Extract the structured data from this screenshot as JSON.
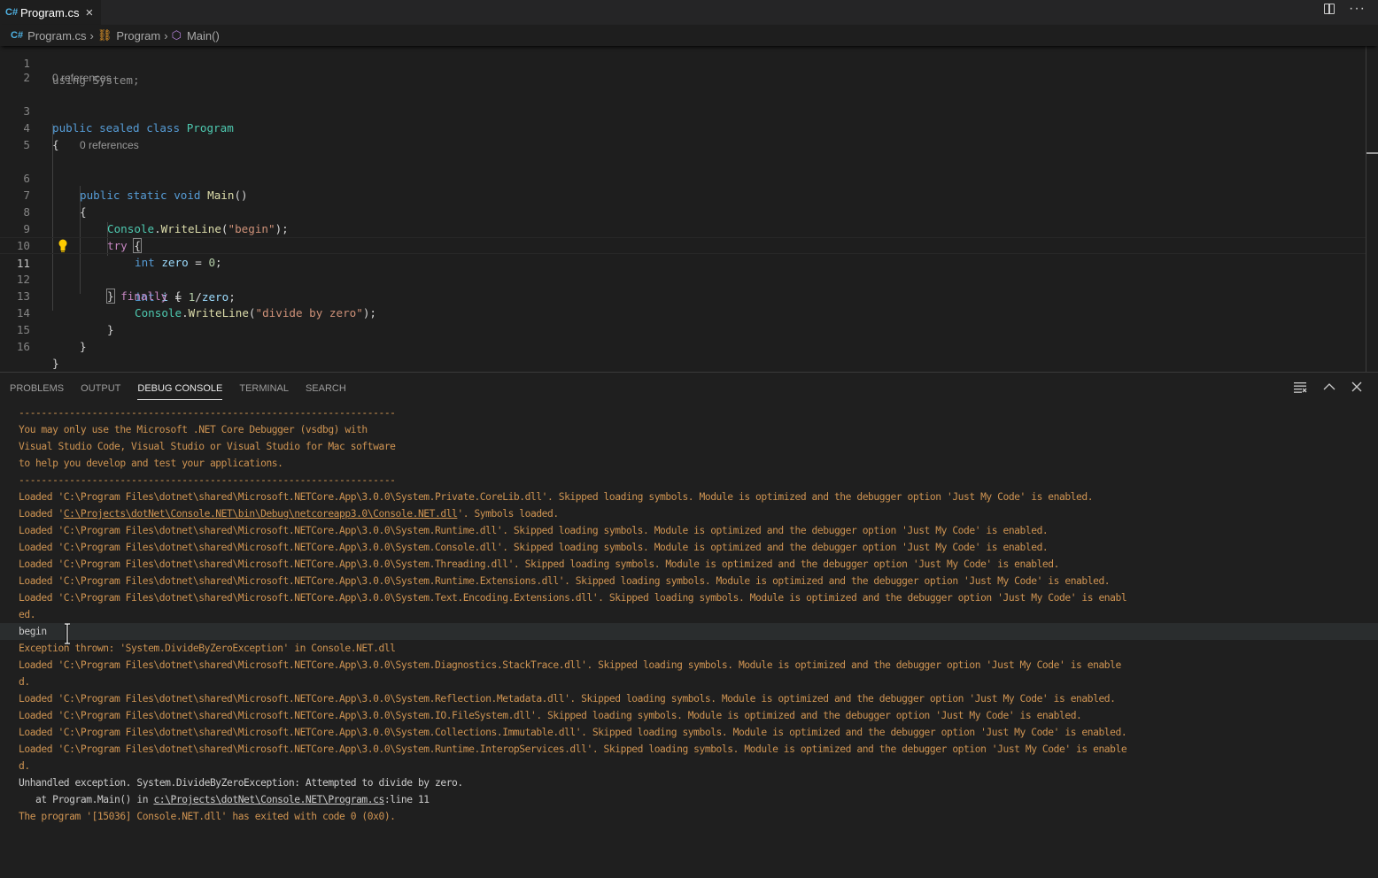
{
  "tab": {
    "label": "Program.cs",
    "icon": "csharp-file-icon"
  },
  "editor_actions": {
    "split": "split-editor-icon",
    "more": "ellipsis-icon"
  },
  "breadcrumb": [
    {
      "label": "Program.cs",
      "icon": "csharp-file-icon"
    },
    {
      "label": "Program",
      "icon": "class-icon"
    },
    {
      "label": "Main()",
      "icon": "method-cube-icon"
    }
  ],
  "code": {
    "codelens": "0 references",
    "partial_line1": "using System;",
    "lines": [
      "1",
      "2",
      "3",
      "4",
      "5",
      "6",
      "7",
      "8",
      "9",
      "10",
      "11",
      "12",
      "13",
      "14",
      "15",
      "16"
    ],
    "t": {
      "public": "public",
      "sealed": "sealed",
      "class": "class",
      "Program": "Program",
      "static": "static",
      "void": "void",
      "Main": "Main",
      "parens": "()",
      "lbrace": "{",
      "rbrace": "}",
      "Console": "Console",
      "dot": ".",
      "WriteLine": "WriteLine",
      "lp": "(",
      "rp_semi": ");",
      "begin_str": "\"begin\"",
      "try": "try",
      "int": "int",
      "zero": "zero",
      "i": "i",
      "eq": " = ",
      "zero_num": "0",
      "semi": ";",
      "one": "1",
      "slash": "/",
      "finally": "finally",
      "divide_str": "\"divide by zero\""
    }
  },
  "panel": {
    "tabs": [
      {
        "label": "PROBLEMS",
        "active": false
      },
      {
        "label": "OUTPUT",
        "active": false
      },
      {
        "label": "DEBUG CONSOLE",
        "active": true
      },
      {
        "label": "TERMINAL",
        "active": false
      },
      {
        "label": "SEARCH",
        "active": false
      }
    ],
    "actions": [
      "clear-console-icon",
      "maximize-panel-icon",
      "close-panel-icon"
    ]
  },
  "console": [
    {
      "text": "-------------------------------------------------------------------",
      "kind": "warn"
    },
    {
      "text": "You may only use the Microsoft .NET Core Debugger (vsdbg) with",
      "kind": "warn"
    },
    {
      "text": "Visual Studio Code, Visual Studio or Visual Studio for Mac software",
      "kind": "warn"
    },
    {
      "text": "to help you develop and test your applications.",
      "kind": "warn"
    },
    {
      "text": "-------------------------------------------------------------------",
      "kind": "warn"
    },
    {
      "text": "Loaded 'C:\\Program Files\\dotnet\\shared\\Microsoft.NETCore.App\\3.0.0\\System.Private.CoreLib.dll'. Skipped loading symbols. Module is optimized and the debugger option 'Just My Code' is enabled.",
      "kind": "warn"
    },
    {
      "pre": "Loaded '",
      "link": "C:\\Projects\\dotNet\\Console.NET\\bin\\Debug\\netcoreapp3.0\\Console.NET.dll",
      "post": "'. Symbols loaded.",
      "kind": "warn"
    },
    {
      "text": "Loaded 'C:\\Program Files\\dotnet\\shared\\Microsoft.NETCore.App\\3.0.0\\System.Runtime.dll'. Skipped loading symbols. Module is optimized and the debugger option 'Just My Code' is enabled.",
      "kind": "warn"
    },
    {
      "text": "Loaded 'C:\\Program Files\\dotnet\\shared\\Microsoft.NETCore.App\\3.0.0\\System.Console.dll'. Skipped loading symbols. Module is optimized and the debugger option 'Just My Code' is enabled.",
      "kind": "warn"
    },
    {
      "text": "Loaded 'C:\\Program Files\\dotnet\\shared\\Microsoft.NETCore.App\\3.0.0\\System.Threading.dll'. Skipped loading symbols. Module is optimized and the debugger option 'Just My Code' is enabled.",
      "kind": "warn"
    },
    {
      "text": "Loaded 'C:\\Program Files\\dotnet\\shared\\Microsoft.NETCore.App\\3.0.0\\System.Runtime.Extensions.dll'. Skipped loading symbols. Module is optimized and the debugger option 'Just My Code' is enabled.",
      "kind": "warn"
    },
    {
      "text": "Loaded 'C:\\Program Files\\dotnet\\shared\\Microsoft.NETCore.App\\3.0.0\\System.Text.Encoding.Extensions.dll'. Skipped loading symbols. Module is optimized and the debugger option 'Just My Code' is enabl",
      "kind": "warn"
    },
    {
      "text": "ed.",
      "kind": "warn"
    },
    {
      "text": "begin",
      "kind": "plain",
      "highlight": true
    },
    {
      "text": "Exception thrown: 'System.DivideByZeroException' in Console.NET.dll",
      "kind": "warn"
    },
    {
      "text": "Loaded 'C:\\Program Files\\dotnet\\shared\\Microsoft.NETCore.App\\3.0.0\\System.Diagnostics.StackTrace.dll'. Skipped loading symbols. Module is optimized and the debugger option 'Just My Code' is enable",
      "kind": "warn"
    },
    {
      "text": "d.",
      "kind": "warn"
    },
    {
      "text": "Loaded 'C:\\Program Files\\dotnet\\shared\\Microsoft.NETCore.App\\3.0.0\\System.Reflection.Metadata.dll'. Skipped loading symbols. Module is optimized and the debugger option 'Just My Code' is enabled.",
      "kind": "warn"
    },
    {
      "text": "Loaded 'C:\\Program Files\\dotnet\\shared\\Microsoft.NETCore.App\\3.0.0\\System.IO.FileSystem.dll'. Skipped loading symbols. Module is optimized and the debugger option 'Just My Code' is enabled.",
      "kind": "warn"
    },
    {
      "text": "Loaded 'C:\\Program Files\\dotnet\\shared\\Microsoft.NETCore.App\\3.0.0\\System.Collections.Immutable.dll'. Skipped loading symbols. Module is optimized and the debugger option 'Just My Code' is enabled.",
      "kind": "warn"
    },
    {
      "text": "Loaded 'C:\\Program Files\\dotnet\\shared\\Microsoft.NETCore.App\\3.0.0\\System.Runtime.InteropServices.dll'. Skipped loading symbols. Module is optimized and the debugger option 'Just My Code' is enable",
      "kind": "warn"
    },
    {
      "text": "d.",
      "kind": "warn"
    },
    {
      "text": "Unhandled exception. System.DivideByZeroException: Attempted to divide by zero.",
      "kind": "plain"
    },
    {
      "pre": "   at Program.Main() in ",
      "link": "c:\\Projects\\dotNet\\Console.NET\\Program.cs",
      "post": ":line 11",
      "kind": "plain"
    },
    {
      "text": "The program '[15036] Console.NET.dll' has exited with code 0 (0x0).",
      "kind": "warn"
    }
  ],
  "colors": {
    "warning_text": "#cf9452",
    "plain_text": "#cccccc",
    "accent_tab": "#e7e7e7"
  }
}
